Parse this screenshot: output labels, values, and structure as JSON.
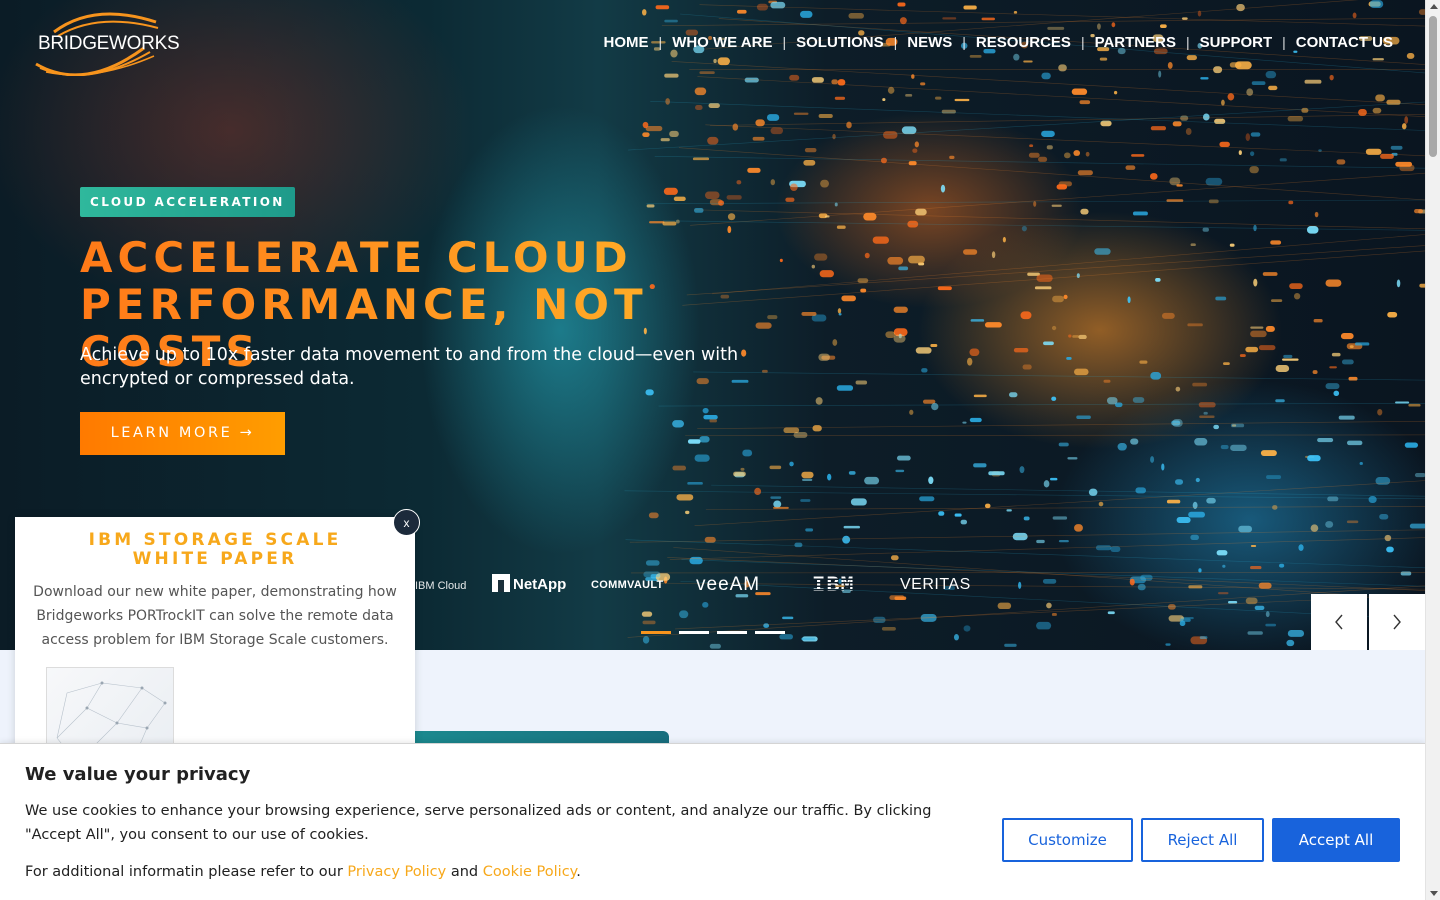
{
  "brand": {
    "logo_text": "BRIDGEWORKS"
  },
  "nav": {
    "items": [
      {
        "label": "HOME"
      },
      {
        "label": "WHO WE ARE"
      },
      {
        "label": "SOLUTIONS"
      },
      {
        "label": "NEWS"
      },
      {
        "label": "RESOURCES"
      },
      {
        "label": "PARTNERS"
      },
      {
        "label": "SUPPORT"
      },
      {
        "label": "CONTACT US"
      }
    ],
    "separator": "|"
  },
  "hero": {
    "tag": "CLOUD ACCELERATION",
    "headline_line1": "ACCELERATE CLOUD",
    "headline_line2": "PERFORMANCE, NOT COSTS",
    "subtitle": "Achieve up to 10x faster data movement to and from the cloud—even with encrypted or compressed data.",
    "cta_label": "LEARN MORE →",
    "partners": [
      "IBM Cloud",
      "NetApp",
      "COMMVAULT",
      "veeAM",
      "IBM",
      "VERITAS"
    ],
    "slides_total": 4,
    "active_slide": 1,
    "colors": {
      "accent_orange": "#f7941d",
      "tag_teal": "#2fb89c"
    }
  },
  "popup": {
    "title": "IBM STORAGE SCALE WHITE PAPER",
    "description": "Download our new white paper, demonstrating how Bridgeworks PORTrockIT can solve the remote data access problem for IBM Storage Scale customers.",
    "close_label": "x"
  },
  "cookie": {
    "title": "We value your privacy",
    "text": "We use cookies to enhance your browsing experience, serve personalized ads or content, and analyze our traffic. By clicking \"Accept All\", you consent to our use of cookies.",
    "text2_prefix": "For additional informatin please refer to our",
    "privacy_link": "Privacy Policy",
    "text2_and": "and",
    "cookie_link": "Cookie Policy",
    "text2_suffix": ".",
    "buttons": {
      "customize": "Customize",
      "reject": "Reject All",
      "accept": "Accept All"
    },
    "colors": {
      "button_blue": "#1863dc",
      "link_orange": "#f7a81b"
    }
  }
}
